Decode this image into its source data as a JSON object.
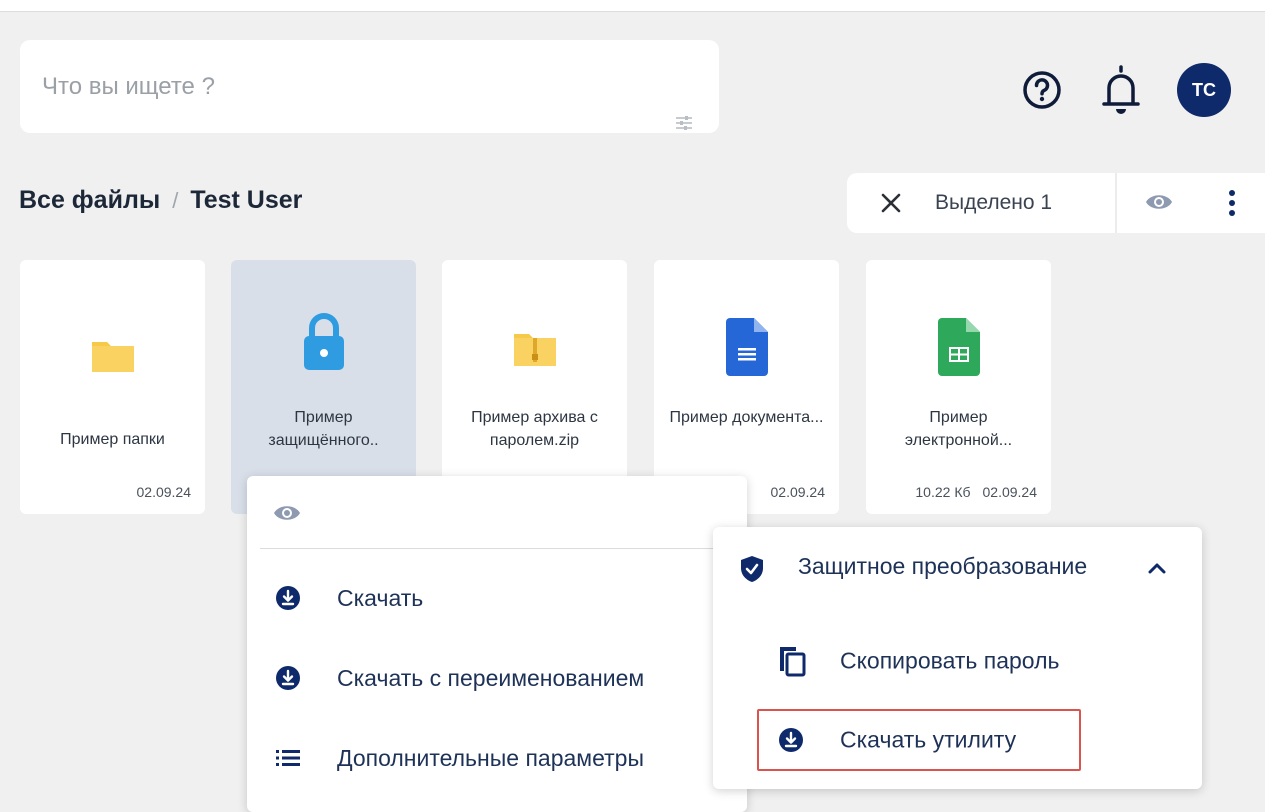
{
  "search": {
    "placeholder": "Что вы ищете ?",
    "value": ""
  },
  "header": {
    "avatar_initials": "ТС"
  },
  "breadcrumb": {
    "root": "Все файлы",
    "separator": "/",
    "current": "Test User"
  },
  "selection": {
    "count_label": "Выделено 1"
  },
  "files": [
    {
      "name": "Пример папки",
      "size": "",
      "date": "02.09.24",
      "icon": "folder-icon"
    },
    {
      "name": "Пример защищённого..",
      "size": "",
      "date": "",
      "icon": "lock-icon"
    },
    {
      "name": "Пример архива с паролем.zip",
      "size": "",
      "date": "",
      "icon": "zip-folder-icon"
    },
    {
      "name": "Пример документа...",
      "size": "",
      "date": "02.09.24",
      "icon": "document-icon"
    },
    {
      "name": "Пример электронной...",
      "size": "10.22 Кб",
      "date": "02.09.24",
      "icon": "spreadsheet-icon"
    }
  ],
  "context_menu": {
    "items": [
      {
        "label": "Скачать",
        "icon": "download-icon"
      },
      {
        "label": "Скачать с переименованием",
        "icon": "download-icon"
      },
      {
        "label": "Дополнительные параметры",
        "icon": "list-icon"
      }
    ]
  },
  "submenu": {
    "title": "Защитное преобразование",
    "items": [
      {
        "label": "Скопировать пароль",
        "icon": "copy-icon"
      },
      {
        "label": "Скачать утилиту",
        "icon": "download-icon"
      }
    ]
  },
  "colors": {
    "accent_dark": "#0e2a6b",
    "menu_text": "#1e3258",
    "highlight_border": "#d9534f",
    "selected_tile": "#d9dfe9",
    "folder": "#f7c948",
    "lock": "#2f9be0",
    "doc": "#2567d6",
    "sheet": "#2ea85a"
  }
}
